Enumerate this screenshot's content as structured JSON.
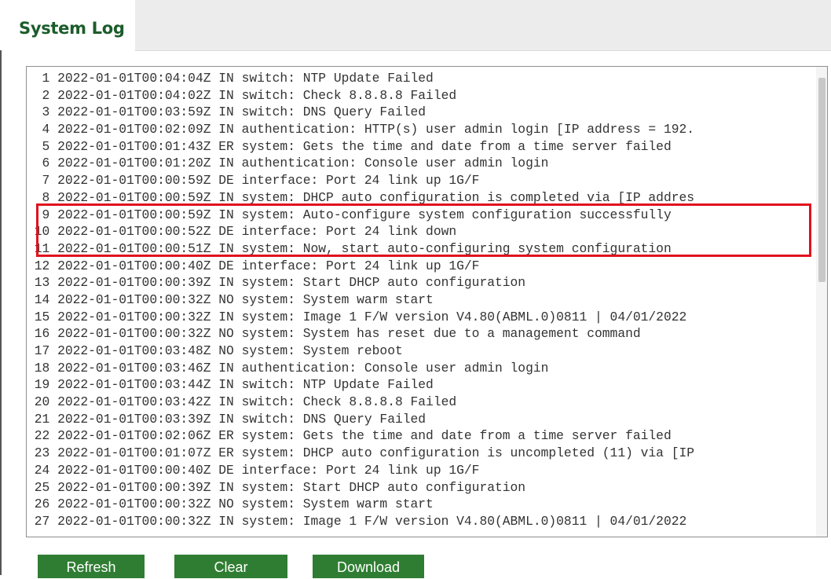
{
  "tab": {
    "title": "System Log"
  },
  "log": {
    "lines": [
      "  1 2022-01-01T00:04:04Z IN switch: NTP Update Failed",
      "  2 2022-01-01T00:04:02Z IN switch: Check 8.8.8.8 Failed",
      "  3 2022-01-01T00:03:59Z IN switch: DNS Query Failed",
      "  4 2022-01-01T00:02:09Z IN authentication: HTTP(s) user admin login [IP address = 192.",
      "  5 2022-01-01T00:01:43Z ER system: Gets the time and date from a time server failed",
      "  6 2022-01-01T00:01:20Z IN authentication: Console user admin login",
      "  7 2022-01-01T00:00:59Z DE interface: Port 24 link up 1G/F",
      "  8 2022-01-01T00:00:59Z IN system: DHCP auto configuration is completed via [IP addres",
      "  9 2022-01-01T00:00:59Z IN system: Auto-configure system configuration successfully",
      " 10 2022-01-01T00:00:52Z DE interface: Port 24 link down",
      " 11 2022-01-01T00:00:51Z IN system: Now, start auto-configuring system configuration",
      " 12 2022-01-01T00:00:40Z DE interface: Port 24 link up 1G/F",
      " 13 2022-01-01T00:00:39Z IN system: Start DHCP auto configuration",
      " 14 2022-01-01T00:00:32Z NO system: System warm start",
      " 15 2022-01-01T00:00:32Z IN system: Image 1 F/W version V4.80(ABML.0)0811 | 04/01/2022",
      " 16 2022-01-01T00:00:32Z NO system: System has reset due to a management command",
      " 17 2022-01-01T00:03:48Z NO system: System reboot",
      " 18 2022-01-01T00:03:46Z IN authentication: Console user admin login",
      " 19 2022-01-01T00:03:44Z IN switch: NTP Update Failed",
      " 20 2022-01-01T00:03:42Z IN switch: Check 8.8.8.8 Failed",
      " 21 2022-01-01T00:03:39Z IN switch: DNS Query Failed",
      " 22 2022-01-01T00:02:06Z ER system: Gets the time and date from a time server failed",
      " 23 2022-01-01T00:01:07Z ER system: DHCP auto configuration is uncompleted (11) via [IP",
      " 24 2022-01-01T00:00:40Z DE interface: Port 24 link up 1G/F",
      " 25 2022-01-01T00:00:39Z IN system: Start DHCP auto configuration",
      " 26 2022-01-01T00:00:32Z NO system: System warm start",
      " 27 2022-01-01T00:00:32Z IN system: Image 1 F/W version V4.80(ABML.0)0811 | 04/01/2022"
    ]
  },
  "buttons": {
    "refresh": "Refresh",
    "clear": "Clear",
    "download": "Download"
  },
  "colors": {
    "title": "#1b5c2b",
    "button": "#2f7d32",
    "highlight": "#e0121d"
  }
}
